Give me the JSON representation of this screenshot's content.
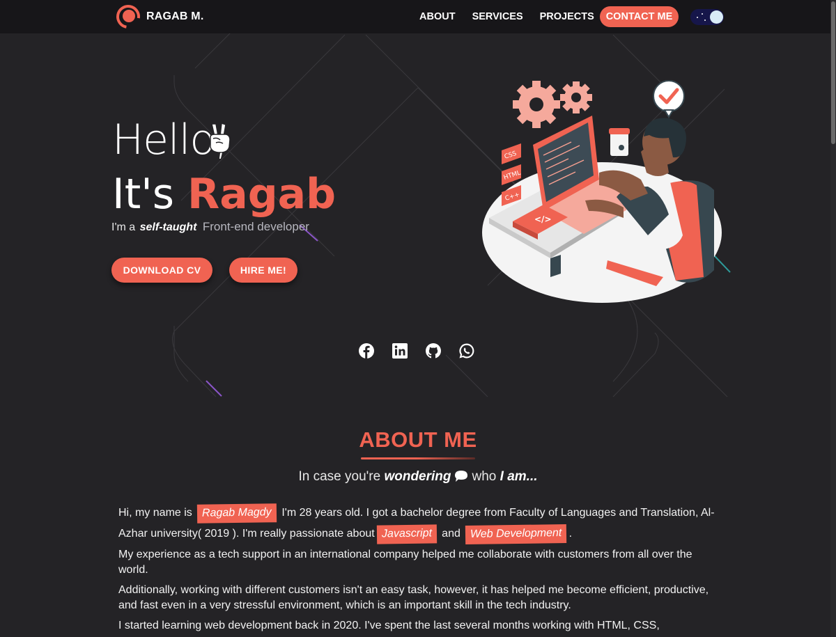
{
  "nav": {
    "brand": "RAGAB M.",
    "links": [
      "ABOUT",
      "SERVICES",
      "PROJECTS"
    ],
    "contact": "CONTACT ME",
    "theme_toggle": "dark-mode"
  },
  "hero": {
    "greeting": "Hello,",
    "intro_prefix": "It's ",
    "name": "Ragab",
    "tagline_prefix": "I'm a",
    "tagline_emphasis": "self-taught",
    "role": "Front-end developer",
    "buttons": {
      "cv": "DOWNLOAD CV",
      "hire": "HIRE ME!"
    },
    "illustration_labels": [
      "CSS",
      "HTML",
      "C++"
    ],
    "socials": [
      "facebook-icon",
      "linkedin-icon",
      "github-icon",
      "whatsapp-icon"
    ]
  },
  "about": {
    "title": "ABOUT ME",
    "subtitle_a": "In case you're",
    "subtitle_b": "wondering",
    "subtitle_c": "who",
    "subtitle_d": "I am...",
    "p1_a": "Hi, my name is",
    "p1_name": "Ragab Magdy",
    "p1_b": "I'm 28 years old. I got a bachelor degree from Faculty of Languages and Translation, Al-Azhar university( 2019 ). I'm really passionate about",
    "p1_js": "Javascript",
    "p1_and": "and",
    "p1_wd": "Web Development",
    "p1_end": ".",
    "p2": "My experience as a tech support in an international company helped me collaborate with customers from all over the world.",
    "p3": "Additionally, working with different customers isn't an easy task, however, it has helped me become efficient, productive, and fast even in a very stressful environment, which is an important skill in the tech industry.",
    "p4": "I started learning web development back in 2020. I've spent the last several months working with HTML, CSS,"
  },
  "colors": {
    "accent": "#f06352",
    "background": "#242326",
    "navbar": "#171619"
  }
}
